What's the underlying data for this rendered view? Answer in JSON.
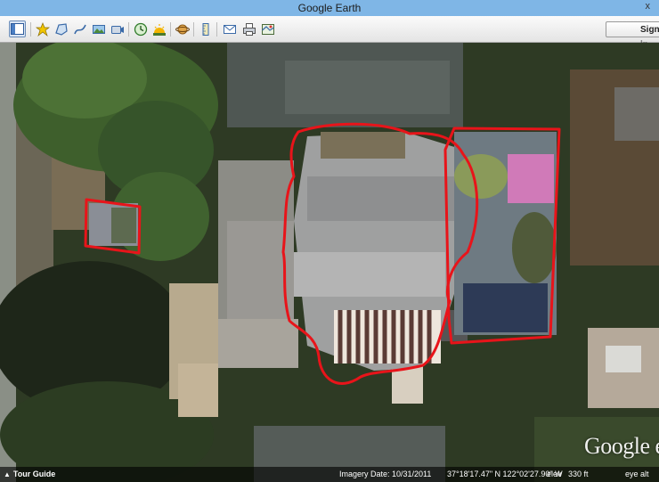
{
  "window": {
    "title": "Google Earth",
    "close_glyph": "x"
  },
  "toolbar": {
    "buttons": [
      {
        "name": "sidebar-toggle-button",
        "icon": "sidebar-icon"
      },
      {
        "name": "add-placemark-button",
        "icon": "placemark-icon"
      },
      {
        "name": "add-polygon-button",
        "icon": "polygon-icon"
      },
      {
        "name": "add-path-button",
        "icon": "path-icon"
      },
      {
        "name": "add-image-overlay-button",
        "icon": "image-overlay-icon"
      },
      {
        "name": "record-tour-button",
        "icon": "record-tour-icon"
      },
      {
        "name": "historical-imagery-button",
        "icon": "clock-icon"
      },
      {
        "name": "sunlight-button",
        "icon": "sun-icon"
      },
      {
        "name": "switch-planet-button",
        "icon": "planet-icon"
      },
      {
        "name": "ruler-button",
        "icon": "ruler-icon"
      },
      {
        "name": "email-button",
        "icon": "email-icon"
      },
      {
        "name": "print-button",
        "icon": "print-icon"
      },
      {
        "name": "view-in-maps-button",
        "icon": "maps-icon"
      }
    ],
    "signin_label": "Sign in"
  },
  "map": {
    "overlay_color": "#e8141a",
    "google_logo": "Google earth"
  },
  "status": {
    "tour_guide": "Tour Guide",
    "imagery_date": "Imagery Date: 10/31/2011",
    "coords": "37°18'17.47\" N  122°02'27.90\" W",
    "elev_label": "elev",
    "elev_value": "330 ft",
    "eye_alt": "eye alt"
  }
}
